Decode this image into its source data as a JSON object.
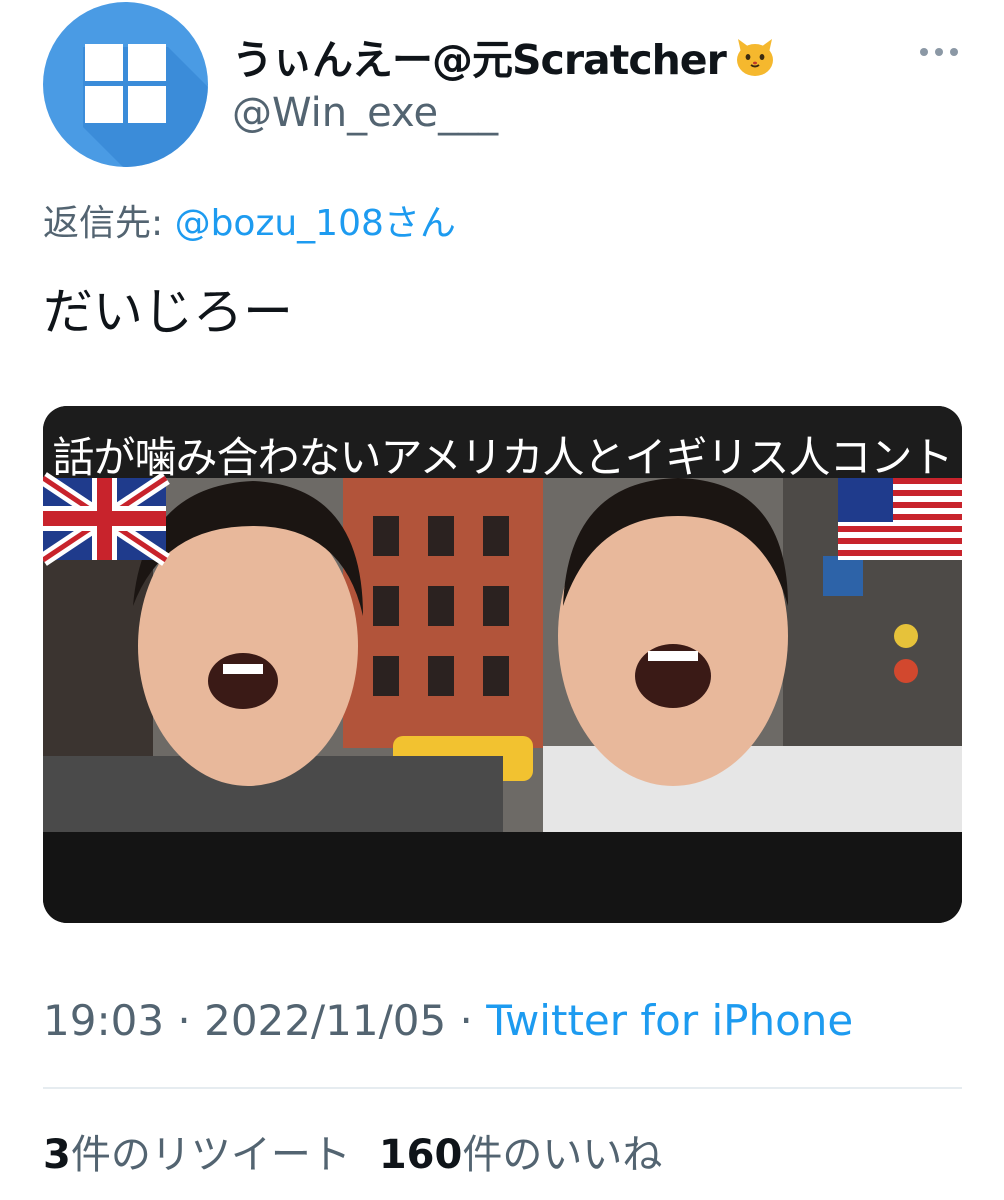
{
  "user": {
    "display_name": "うぃんえー@元Scratcher",
    "handle": "@Win_exe___",
    "avatar_icon": "windows-logo-icon",
    "badge_icon": "cat-face-icon",
    "avatar_color": "#4a9be4"
  },
  "reply": {
    "prefix": "返信先: ",
    "mention": "@bozu_108さん"
  },
  "tweet": {
    "text": "だいじろー"
  },
  "media": {
    "caption": "話が噛み合わないアメリカ人とイギリス人コント",
    "left_flag_icon": "uk-flag-icon",
    "right_flag_icon": "us-flag-icon"
  },
  "meta": {
    "time": "19:03",
    "separator": " · ",
    "date": "2022/11/05",
    "source": "Twitter for iPhone"
  },
  "stats": {
    "retweet_count": "3",
    "retweet_label": "件のリツイート",
    "like_count": "160",
    "like_label": "件のいいね"
  },
  "colors": {
    "link": "#1d9bf0",
    "secondary_text": "#536471"
  }
}
